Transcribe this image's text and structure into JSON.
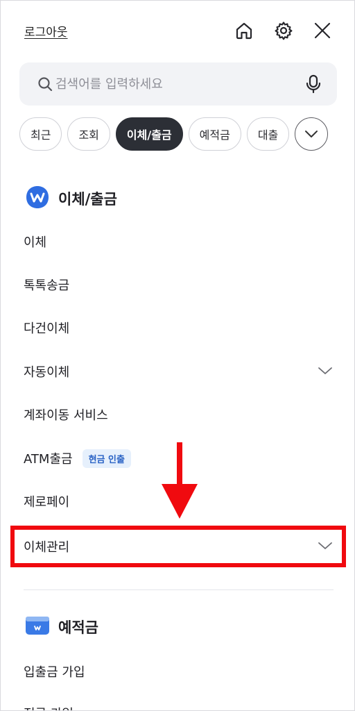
{
  "header": {
    "logout_label": "로그아웃",
    "home_icon": "home-icon",
    "settings_icon": "gear-icon",
    "close_icon": "close-icon"
  },
  "search": {
    "placeholder": "검색어를 입력하세요",
    "value": "",
    "search_icon": "search-icon",
    "mic_icon": "microphone-icon"
  },
  "tabs": [
    {
      "label": "최근",
      "active": false
    },
    {
      "label": "조회",
      "active": false
    },
    {
      "label": "이체/출금",
      "active": true
    },
    {
      "label": "예적금",
      "active": false
    },
    {
      "label": "대출",
      "active": false
    }
  ],
  "tabs_more_icon": "chevron-down-icon",
  "sections": {
    "transfer": {
      "title": "이체/출금",
      "icon": "transfer-badge-icon",
      "items": [
        {
          "label": "이체"
        },
        {
          "label": "톡톡송금"
        },
        {
          "label": "다건이체"
        },
        {
          "label": "자동이체",
          "expandable": true
        },
        {
          "label": "계좌이동 서비스"
        },
        {
          "label": "ATM출금",
          "badge": "현금 인출"
        },
        {
          "label": "제로페이"
        },
        {
          "label": "이체관리",
          "expandable": true,
          "highlighted": true
        }
      ]
    },
    "deposit": {
      "title": "예적금",
      "icon": "deposit-card-icon",
      "items": [
        {
          "label": "입출금 가입"
        },
        {
          "label": "적금 가입"
        }
      ]
    }
  },
  "colors": {
    "accent_blue": "#2f6de1",
    "active_chip": "#2c2f36",
    "highlight_red": "#f00a0f",
    "badge_bg": "#e6f0fc",
    "badge_text": "#2a63c5"
  }
}
